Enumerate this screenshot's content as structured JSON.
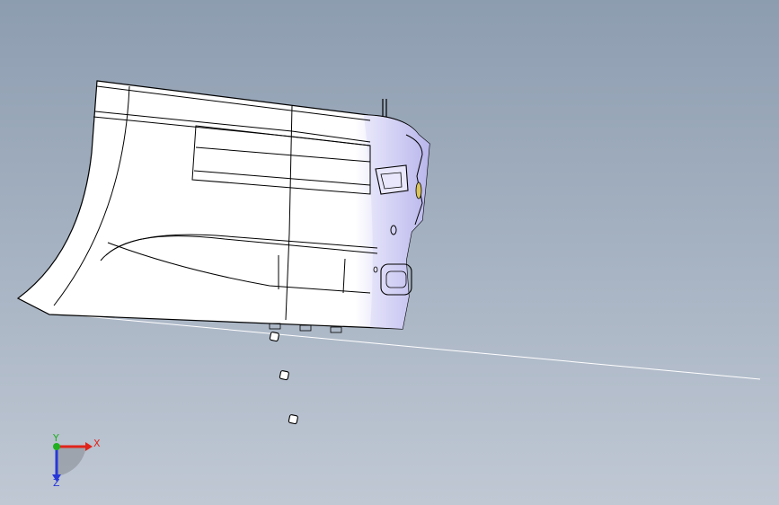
{
  "viewport": {
    "background_top": "#8d9db0",
    "background_bottom": "#c0c8d4",
    "model": {
      "face_color": "#ffffff",
      "shade_color": "#c9c7f2",
      "edge_color": "#000000",
      "highlight_color": "#d8c35a"
    }
  },
  "triad": {
    "x_label": "X",
    "y_label": "Y",
    "z_label": "Z",
    "x_color": "#e0241b",
    "y_color": "#20b020",
    "z_color": "#2838d8"
  }
}
